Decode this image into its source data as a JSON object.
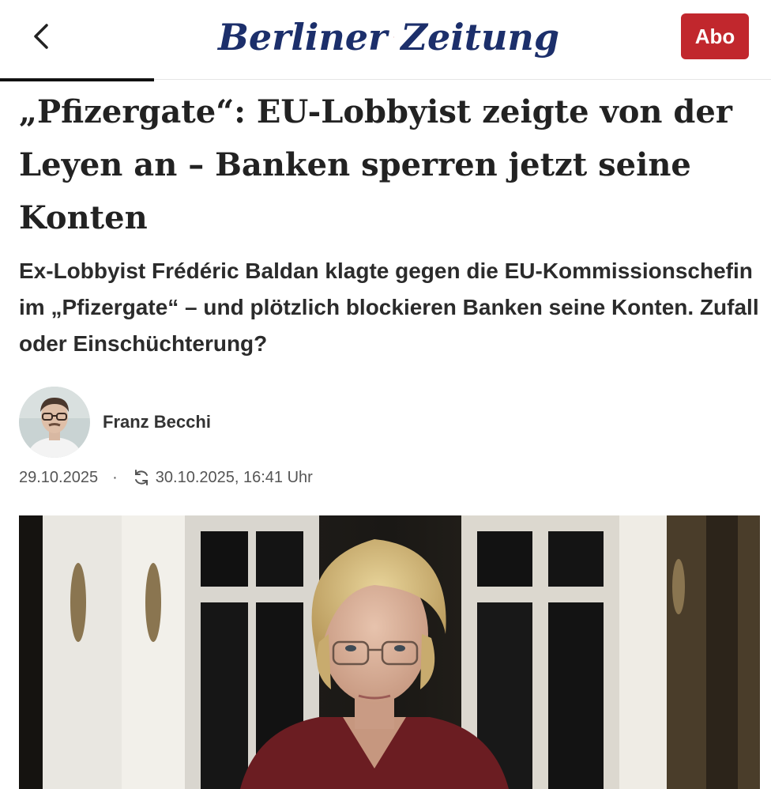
{
  "header": {
    "back_icon": "chevron-left-icon",
    "logo": {
      "word_left": "Berliner",
      "word_right": "Zeitung"
    },
    "subscribe_label": "Abo",
    "brand_red": "#c1272d",
    "brand_blue": "#1c2f6b"
  },
  "reading_progress": 0.2,
  "article": {
    "headline": "„Pfizergate“: EU-Lobbyist zeigte von der Leyen an – Banken sperren jetzt seine Konten",
    "teaser": "Ex-Lobbyist Frédéric Baldan klagte gegen die EU-Kommissionschefin im „Pfizergate“ – und plötzlich blockieren Banken seine Konten. Zufall oder Einschüchterung?",
    "author": {
      "name": "Franz Becchi"
    },
    "published": "29.10.2025",
    "separator": "·",
    "updated": "30.10.2025, 16:41 Uhr"
  }
}
